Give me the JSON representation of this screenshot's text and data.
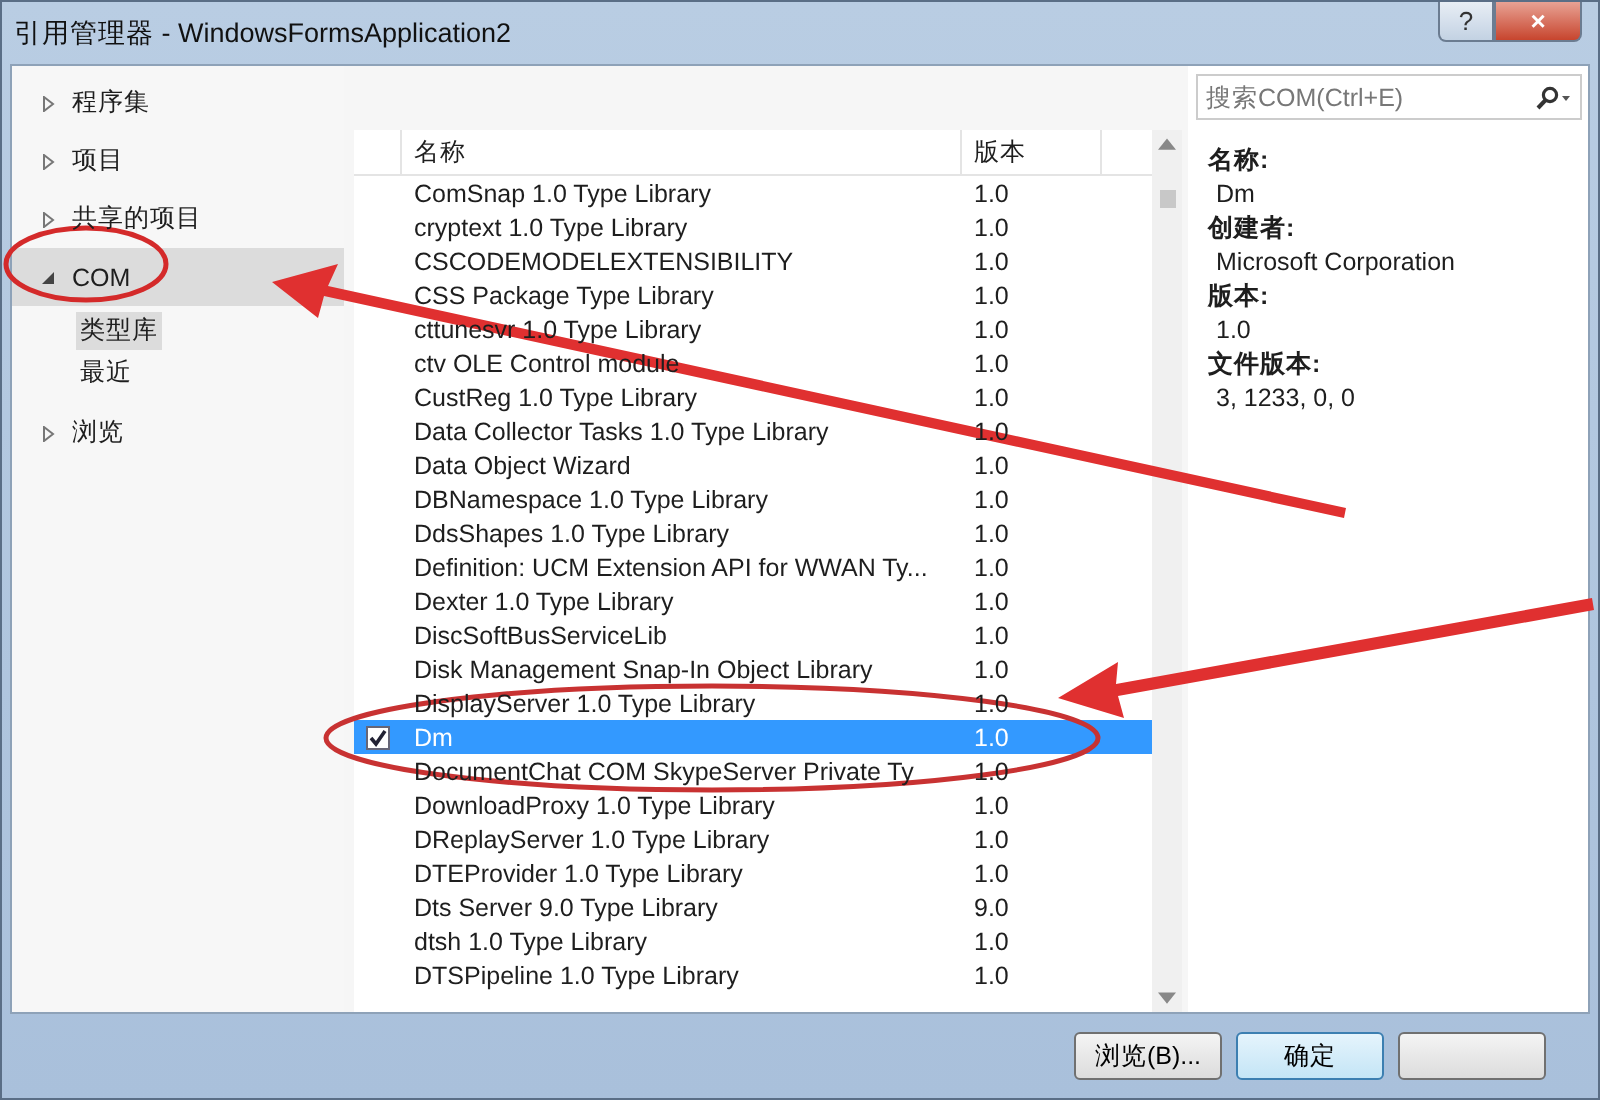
{
  "window": {
    "title": "引用管理器 - WindowsFormsApplication2",
    "help_button": "?",
    "close_button": "×"
  },
  "sidebar": {
    "items": [
      {
        "label": "程序集",
        "expanded": false,
        "selected": false
      },
      {
        "label": "项目",
        "expanded": false,
        "selected": false
      },
      {
        "label": "共享的项目",
        "expanded": false,
        "selected": false
      },
      {
        "label": "COM",
        "expanded": true,
        "selected": true,
        "children": [
          {
            "label": "类型库",
            "selected": true
          },
          {
            "label": "最近",
            "selected": false
          }
        ]
      },
      {
        "label": "浏览",
        "expanded": false,
        "selected": false
      }
    ]
  },
  "search": {
    "placeholder": "搜索COM(Ctrl+E)"
  },
  "table": {
    "columns": [
      "名称",
      "版本"
    ],
    "rows": [
      {
        "name": "ComSnap 1.0 Type Library",
        "version": "1.0",
        "checked": false,
        "selected": false
      },
      {
        "name": "cryptext 1.0 Type Library",
        "version": "1.0",
        "checked": false,
        "selected": false
      },
      {
        "name": "CSCODEMODELEXTENSIBILITY",
        "version": "1.0",
        "checked": false,
        "selected": false
      },
      {
        "name": "CSS Package Type Library",
        "version": "1.0",
        "checked": false,
        "selected": false
      },
      {
        "name": "cttunesvr 1.0 Type Library",
        "version": "1.0",
        "checked": false,
        "selected": false
      },
      {
        "name": "ctv OLE Control module",
        "version": "1.0",
        "checked": false,
        "selected": false
      },
      {
        "name": "CustReg 1.0 Type Library",
        "version": "1.0",
        "checked": false,
        "selected": false
      },
      {
        "name": "Data Collector Tasks 1.0 Type Library",
        "version": "1.0",
        "checked": false,
        "selected": false
      },
      {
        "name": "Data Object Wizard",
        "version": "1.0",
        "checked": false,
        "selected": false
      },
      {
        "name": "DBNamespace 1.0 Type Library",
        "version": "1.0",
        "checked": false,
        "selected": false
      },
      {
        "name": "DdsShapes 1.0 Type Library",
        "version": "1.0",
        "checked": false,
        "selected": false
      },
      {
        "name": "Definition: UCM Extension API for WWAN Ty...",
        "version": "1.0",
        "checked": false,
        "selected": false
      },
      {
        "name": "Dexter 1.0 Type Library",
        "version": "1.0",
        "checked": false,
        "selected": false
      },
      {
        "name": "DiscSoftBusServiceLib",
        "version": "1.0",
        "checked": false,
        "selected": false
      },
      {
        "name": "Disk Management Snap-In Object Library",
        "version": "1.0",
        "checked": false,
        "selected": false
      },
      {
        "name": "DisplayServer 1.0 Type Library",
        "version": "1.0",
        "checked": false,
        "selected": false
      },
      {
        "name": "Dm",
        "version": "1.0",
        "checked": true,
        "selected": true
      },
      {
        "name": "DocumentChat COM SkypeServer Private Ty",
        "version": "1.0",
        "checked": false,
        "selected": false
      },
      {
        "name": "DownloadProxy 1.0 Type Library",
        "version": "1.0",
        "checked": false,
        "selected": false
      },
      {
        "name": "DReplayServer 1.0 Type Library",
        "version": "1.0",
        "checked": false,
        "selected": false
      },
      {
        "name": "DTEProvider 1.0 Type Library",
        "version": "1.0",
        "checked": false,
        "selected": false
      },
      {
        "name": "Dts Server 9.0 Type Library",
        "version": "9.0",
        "checked": false,
        "selected": false
      },
      {
        "name": "dtsh 1.0 Type Library",
        "version": "1.0",
        "checked": false,
        "selected": false
      },
      {
        "name": "DTSPipeline 1.0 Type Library",
        "version": "1.0",
        "checked": false,
        "selected": false
      }
    ]
  },
  "details": [
    {
      "label": "名称:",
      "value": "Dm"
    },
    {
      "label": "创建者:",
      "value": "Microsoft Corporation"
    },
    {
      "label": "版本:",
      "value": "1.0"
    },
    {
      "label": "文件版本:",
      "value": "3, 1233, 0, 0"
    }
  ],
  "buttons": [
    "浏览(B)...",
    "确定"
  ]
}
